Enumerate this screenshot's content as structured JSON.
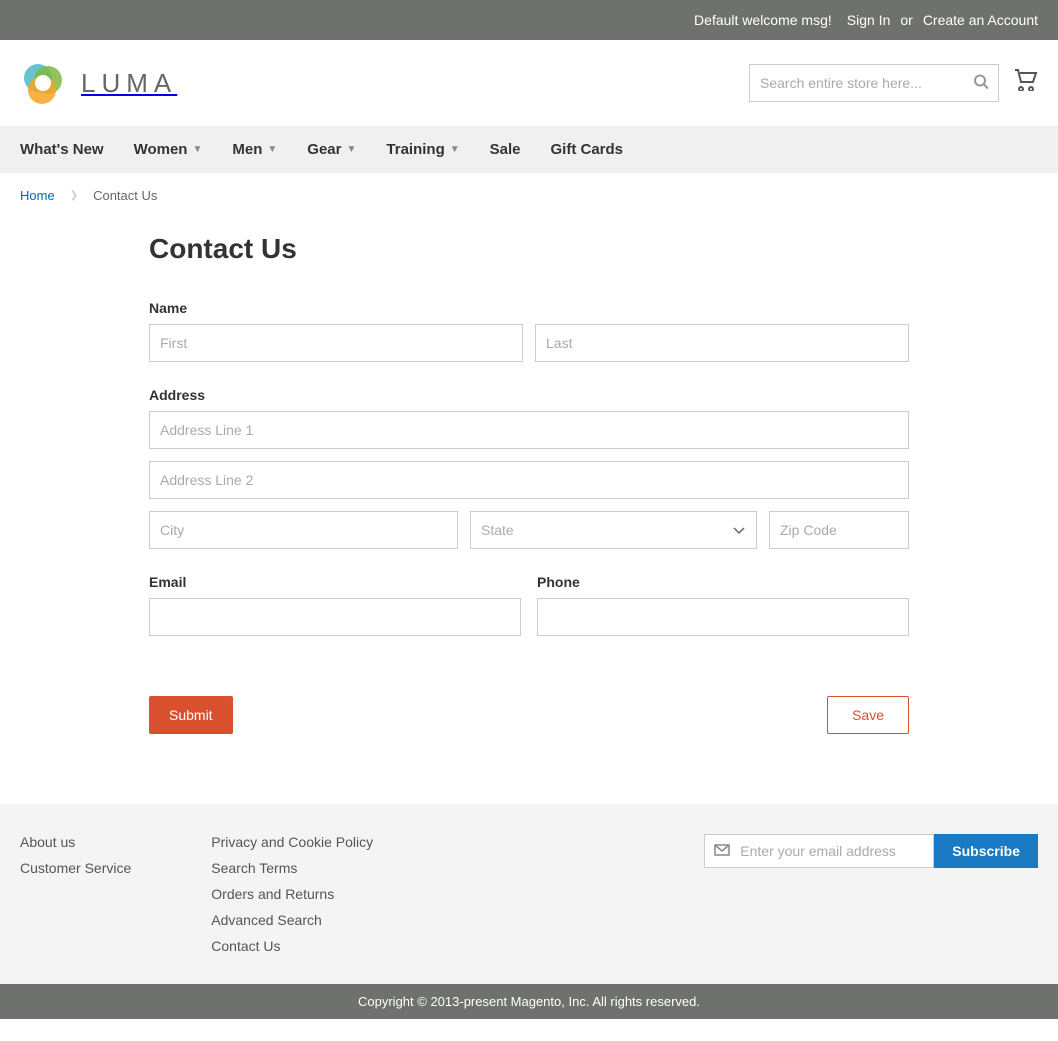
{
  "top_bar": {
    "welcome": "Default welcome msg!",
    "sign_in": "Sign In",
    "or": "or",
    "create_account": "Create an Account"
  },
  "header": {
    "logo_text": "LUMA",
    "search_placeholder": "Search entire store here..."
  },
  "nav": {
    "items": [
      {
        "label": "What's New",
        "dropdown": false
      },
      {
        "label": "Women",
        "dropdown": true
      },
      {
        "label": "Men",
        "dropdown": true
      },
      {
        "label": "Gear",
        "dropdown": true
      },
      {
        "label": "Training",
        "dropdown": true
      },
      {
        "label": "Sale",
        "dropdown": false
      },
      {
        "label": "Gift Cards",
        "dropdown": false
      }
    ]
  },
  "breadcrumb": {
    "home": "Home",
    "current": "Contact Us"
  },
  "page": {
    "title": "Contact Us"
  },
  "form": {
    "name_label": "Name",
    "first_placeholder": "First",
    "last_placeholder": "Last",
    "address_label": "Address",
    "addr1_placeholder": "Address Line 1",
    "addr2_placeholder": "Address Line 2",
    "city_placeholder": "City",
    "state_placeholder": "State",
    "zip_placeholder": "Zip Code",
    "email_label": "Email",
    "phone_label": "Phone",
    "submit_label": "Submit",
    "save_label": "Save"
  },
  "footer": {
    "col1": [
      {
        "label": "About us"
      },
      {
        "label": "Customer Service"
      }
    ],
    "col2": [
      {
        "label": "Privacy and Cookie Policy"
      },
      {
        "label": "Search Terms"
      },
      {
        "label": "Orders and Returns"
      },
      {
        "label": "Advanced Search"
      },
      {
        "label": "Contact Us"
      }
    ],
    "newsletter_placeholder": "Enter your email address",
    "subscribe_label": "Subscribe"
  },
  "copyright": "Copyright © 2013-present Magento, Inc. All rights reserved."
}
